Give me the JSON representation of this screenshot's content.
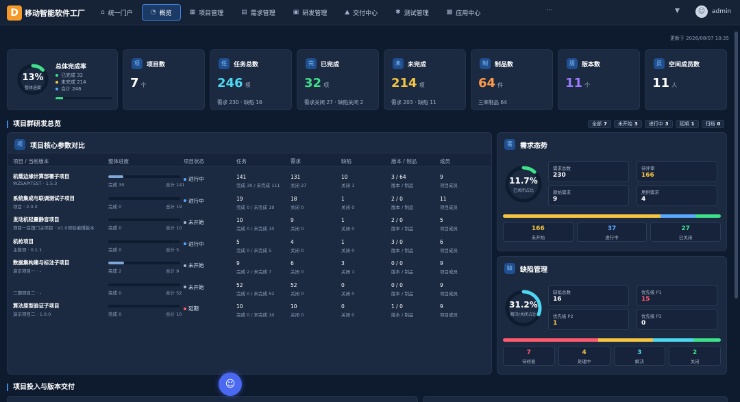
{
  "app": {
    "logo_text": "D",
    "brand": "移动智能软件工厂",
    "user": "admin",
    "update_time": "更新于 2026/08/07 10:35"
  },
  "nav": [
    {
      "label": "统一门户",
      "icon": "home-icon",
      "glyph": "⌂",
      "active": false
    },
    {
      "label": "概览",
      "icon": "dashboard-icon",
      "glyph": "◔",
      "active": true
    },
    {
      "label": "项目管理",
      "icon": "grid-icon",
      "glyph": "▦",
      "active": false
    },
    {
      "label": "需求管理",
      "icon": "document-icon",
      "glyph": "▤",
      "active": false
    },
    {
      "label": "研发管理",
      "icon": "code-icon",
      "glyph": "▣",
      "active": false
    },
    {
      "label": "交付中心",
      "icon": "rocket-icon",
      "glyph": "▲",
      "active": false
    },
    {
      "label": "测试管理",
      "icon": "bug-icon",
      "glyph": "✱",
      "active": false
    },
    {
      "label": "应用中心",
      "icon": "apps-icon",
      "glyph": "▩",
      "active": false
    }
  ],
  "nav_more": "···",
  "overall": {
    "percent": 13,
    "percent_text": "13%",
    "ring_label": "整体进度",
    "title": "总体完成率",
    "legend": [
      "已完成 32",
      "未完成 214",
      "合计 246"
    ],
    "legend_colors": [
      "#3ee08a",
      "#f5c542",
      "#5aa8ff"
    ],
    "progress": 0.13
  },
  "stats": [
    {
      "badge": "项",
      "title": "项目数",
      "value": "7",
      "unit": "个",
      "sub": "",
      "color": "#ffffff"
    },
    {
      "badge": "任",
      "title": "任务总数",
      "value": "246",
      "unit": "项",
      "sub": "需求 230 · 缺陷 16",
      "color": "#4fd6f0"
    },
    {
      "badge": "完",
      "title": "已完成",
      "value": "32",
      "unit": "项",
      "sub": "需求关闭 27 · 缺陷关闭 2",
      "color": "#3ee08a"
    },
    {
      "badge": "未",
      "title": "未完成",
      "value": "214",
      "unit": "项",
      "sub": "需求 203 · 缺陷 11",
      "color": "#f5c542"
    },
    {
      "badge": "制",
      "title": "制品数",
      "value": "64",
      "unit": "件",
      "sub": "三库制品 64",
      "color": "#ff9a4a"
    },
    {
      "badge": "版",
      "title": "版本数",
      "value": "11",
      "unit": "个",
      "sub": "",
      "color": "#9b7bff"
    },
    {
      "badge": "员",
      "title": "空间成员数",
      "value": "11",
      "unit": "人",
      "sub": "",
      "color": "#ffffff"
    }
  ],
  "section1": {
    "title": "项目群研发总览"
  },
  "filters": [
    {
      "label": "全部",
      "count": "7"
    },
    {
      "label": "未开始",
      "count": "3"
    },
    {
      "label": "进行中",
      "count": "3"
    },
    {
      "label": "延期",
      "count": "1"
    },
    {
      "label": "归档",
      "count": "0"
    }
  ],
  "table": {
    "badge": "项",
    "title": "项目核心参数对比",
    "headers": [
      "项目 / 当前版本",
      "整体进度",
      "项目状态",
      "任务",
      "需求",
      "缺陷",
      "版本 / 制品",
      "成员"
    ],
    "rows": [
      {
        "name": "机载边缘计算部署子项目",
        "version": "WZSAPITEST · 1.5.3",
        "progress": 0.21,
        "done": "完成 30",
        "total": "合计 141",
        "status": "进行中",
        "status_color": "#5aa8ff",
        "task": "141",
        "task_sub": "完成 30 / 未完成 111",
        "req": "131",
        "req_sub": "关闭 27",
        "bug": "10",
        "bug_sub": "关闭 1",
        "ver": "3 / 64",
        "ver_sub": "版本 / 制品",
        "mem": "9",
        "mem_sub": "项目成员"
      },
      {
        "name": "系统集成与联调测试子项目",
        "version": "项目 · 2.0.0",
        "progress": 0,
        "done": "完成 0",
        "total": "合计 19",
        "status": "进行中",
        "status_color": "#5aa8ff",
        "task": "19",
        "task_sub": "完成 0 / 未完成 19",
        "req": "18",
        "req_sub": "关闭 0",
        "bug": "1",
        "bug_sub": "关闭 0",
        "ver": "2 / 0",
        "ver_sub": "版本 / 制品",
        "mem": "11",
        "mem_sub": "项目成员"
      },
      {
        "name": "发动机轻量静音项目",
        "version": "项目一白国门主项目 · V1.0测验编辑版本",
        "progress": 0,
        "done": "完成 0",
        "total": "合计 10",
        "status": "未开始",
        "status_color": "#a9b7cc",
        "task": "10",
        "task_sub": "完成 0 / 未完成 10",
        "req": "9",
        "req_sub": "关闭 0",
        "bug": "1",
        "bug_sub": "关闭 0",
        "ver": "2 / 0",
        "ver_sub": "版本 / 制品",
        "mem": "5",
        "mem_sub": "项目成员"
      },
      {
        "name": "机枪项目",
        "version": "主数项 · 0.1.1",
        "progress": 0,
        "done": "完成 0",
        "total": "合计 5",
        "status": "进行中",
        "status_color": "#5aa8ff",
        "task": "5",
        "task_sub": "完成 0 / 未完成 5",
        "req": "4",
        "req_sub": "关闭 0",
        "bug": "1",
        "bug_sub": "关闭 0",
        "ver": "3 / 0",
        "ver_sub": "版本 / 制品",
        "mem": "6",
        "mem_sub": "项目成员"
      },
      {
        "name": "数据集构建与标注子项目",
        "version": "演示项目一 · -",
        "progress": 0.22,
        "done": "完成 2",
        "total": "合计 9",
        "status": "未开始",
        "status_color": "#a9b7cc",
        "task": "9",
        "task_sub": "完成 2 / 未完成 7",
        "req": "6",
        "req_sub": "关闭 0",
        "bug": "3",
        "bug_sub": "关闭 1",
        "ver": "0 / 0",
        "ver_sub": "版本 / 制品",
        "mem": "9",
        "mem_sub": "项目成员"
      },
      {
        "name": "",
        "version": "二期项目二 · -",
        "progress": 0,
        "done": "完成 0",
        "total": "合计 52",
        "status": "未开始",
        "status_color": "#a9b7cc",
        "task": "52",
        "task_sub": "完成 0 / 未完成 52",
        "req": "52",
        "req_sub": "关闭 0",
        "bug": "0",
        "bug_sub": "关闭 0",
        "ver": "0 / 0",
        "ver_sub": "版本 / 制品",
        "mem": "9",
        "mem_sub": "项目成员"
      },
      {
        "name": "算法原型验证子项目",
        "version": "演示项目二 · 1.0.0",
        "progress": 0,
        "done": "完成 0",
        "total": "合计 10",
        "status": "延期",
        "status_color": "#ff5a6e",
        "task": "10",
        "task_sub": "完成 0 / 未完成 10",
        "req": "10",
        "req_sub": "关闭 0",
        "bug": "0",
        "bug_sub": "关闭 0",
        "ver": "1 / 0",
        "ver_sub": "版本 / 制品",
        "mem": "9",
        "mem_sub": "项目成员"
      }
    ]
  },
  "demand": {
    "badge": "需",
    "title": "需求态势",
    "percent": 11.7,
    "percent_text": "11.7%",
    "ring_label": "已关闭占比",
    "ring_color": "#3ee08a",
    "boxes": [
      {
        "label": "需求总数",
        "value": "230",
        "color": "#ffffff"
      },
      {
        "label": "待评审",
        "value": "166",
        "color": "#f5c542"
      },
      {
        "label": "原始需求",
        "value": "9",
        "color": "#ffffff"
      },
      {
        "label": "用例需求",
        "value": "4",
        "color": "#ffffff"
      }
    ],
    "bar": [
      {
        "value": 166,
        "color": "#f5c542"
      },
      {
        "value": 37,
        "color": "#5aa8ff"
      },
      {
        "value": 27,
        "color": "#3ee08a"
      }
    ],
    "tiles": [
      {
        "value": "166",
        "label": "未开始",
        "color": "#f5c542"
      },
      {
        "value": "37",
        "label": "进行中",
        "color": "#5aa8ff"
      },
      {
        "value": "27",
        "label": "已关闭",
        "color": "#3ee08a"
      }
    ]
  },
  "defect": {
    "badge": "缺",
    "title": "缺陷管理",
    "percent": 31.2,
    "percent_text": "31.2%",
    "ring_label": "解决/关闭占比",
    "ring_color": "#4fd6f0",
    "boxes": [
      {
        "label": "缺陷总数",
        "value": "16",
        "color": "#ffffff"
      },
      {
        "label": "优先级 P1",
        "value": "15",
        "color": "#ff5a6e"
      },
      {
        "label": "优先级 P2",
        "value": "1",
        "color": "#f5c542"
      },
      {
        "label": "优先级 P3",
        "value": "0",
        "color": "#ffffff"
      }
    ],
    "bar": [
      {
        "value": 7,
        "color": "#ff5a6e"
      },
      {
        "value": 4,
        "color": "#f5c542"
      },
      {
        "value": 3,
        "color": "#4fd6f0"
      },
      {
        "value": 2,
        "color": "#3ee08a"
      }
    ],
    "tiles": [
      {
        "value": "7",
        "label": "待修复",
        "color": "#ff5a6e"
      },
      {
        "value": "4",
        "label": "处理中",
        "color": "#f5c542"
      },
      {
        "value": "3",
        "label": "解决",
        "color": "#4fd6f0"
      },
      {
        "value": "2",
        "label": "关闭",
        "color": "#3ee08a"
      }
    ]
  },
  "section2": {
    "title": "项目投入与版本交付"
  },
  "fab": {
    "icon": "assistant-icon",
    "glyph": "☺"
  }
}
